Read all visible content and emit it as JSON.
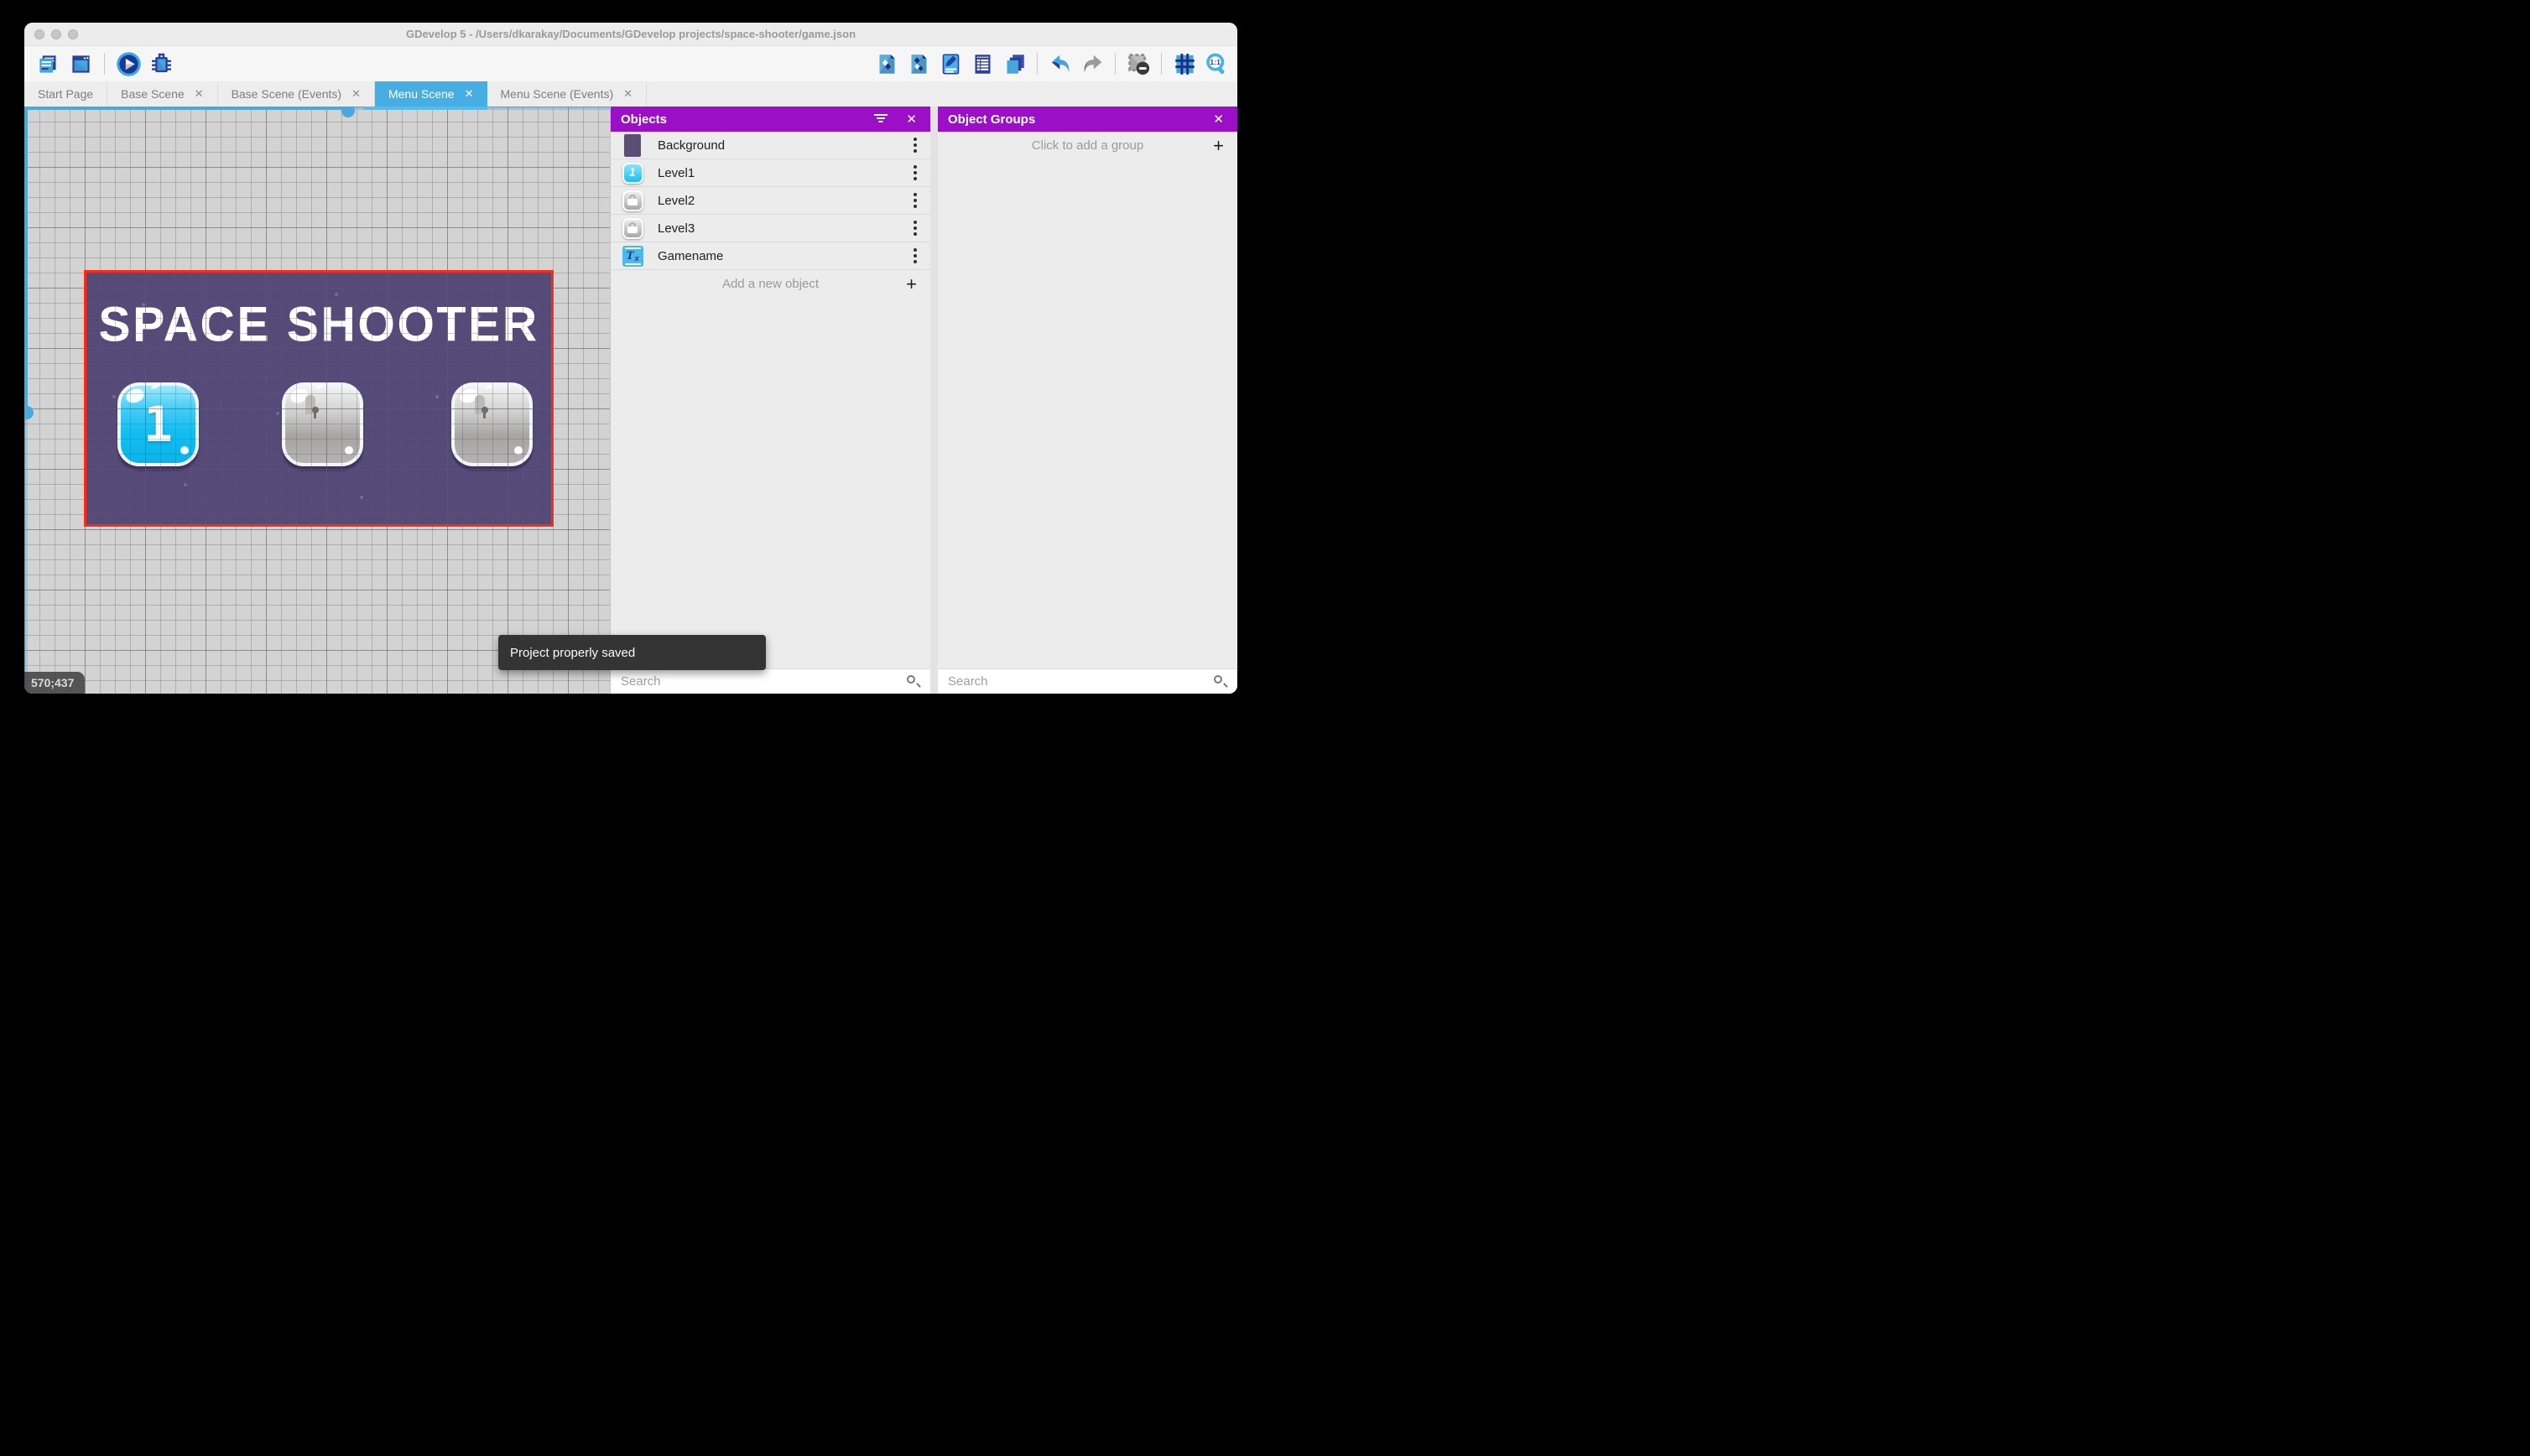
{
  "window": {
    "title": "GDevelop 5 - /Users/dkarakay/Documents/GDevelop projects/space-shooter/game.json",
    "traffic_lights": [
      "close",
      "minimize",
      "zoom"
    ]
  },
  "toolbar": {
    "left_icons": [
      "project-manager-icon",
      "start-page-icon",
      "play-icon",
      "debug-icon"
    ],
    "right_icons": [
      "objects-editor-icon",
      "object-groups-icon",
      "properties-icon",
      "instances-list-icon",
      "layers-icon",
      "undo-icon",
      "redo-icon",
      "toggle-mask-icon",
      "grid-icon",
      "zoom-original-icon"
    ]
  },
  "tabs": [
    {
      "label": "Start Page",
      "closable": false,
      "active": false
    },
    {
      "label": "Base Scene",
      "closable": true,
      "active": false
    },
    {
      "label": "Base Scene (Events)",
      "closable": true,
      "active": false
    },
    {
      "label": "Menu Scene",
      "closable": true,
      "active": true
    },
    {
      "label": "Menu Scene (Events)",
      "closable": true,
      "active": false
    }
  ],
  "tab_close_glyph": "✕",
  "canvas": {
    "coordinates": "570;437",
    "scene": {
      "title": "SPACE SHOOTER",
      "buttons": [
        {
          "label": "1",
          "state": "unlocked"
        },
        {
          "label": "",
          "state": "locked"
        },
        {
          "label": "",
          "state": "locked"
        }
      ]
    }
  },
  "objects_panel": {
    "title": "Objects",
    "items": [
      {
        "name": "Background",
        "thumb": "background-sprite"
      },
      {
        "name": "Level1",
        "thumb": "level1-button-sprite"
      },
      {
        "name": "Level2",
        "thumb": "locked-button-sprite"
      },
      {
        "name": "Level3",
        "thumb": "locked-button-sprite"
      },
      {
        "name": "Gamename",
        "thumb": "text-object"
      }
    ],
    "add_label": "Add a new object",
    "search_placeholder": "Search",
    "close_glyph": "✕"
  },
  "object_groups_panel": {
    "title": "Object Groups",
    "add_label": "Click to add a group",
    "search_placeholder": "Search",
    "close_glyph": "✕"
  },
  "toast": {
    "message": "Project properly saved"
  },
  "colors": {
    "accent_purple": "#9b10c7",
    "active_tab_blue": "#47aee3",
    "selection_red": "#fd2b14",
    "scene_purple": "#564a78",
    "scrollbar_blue": "#47a9de"
  }
}
